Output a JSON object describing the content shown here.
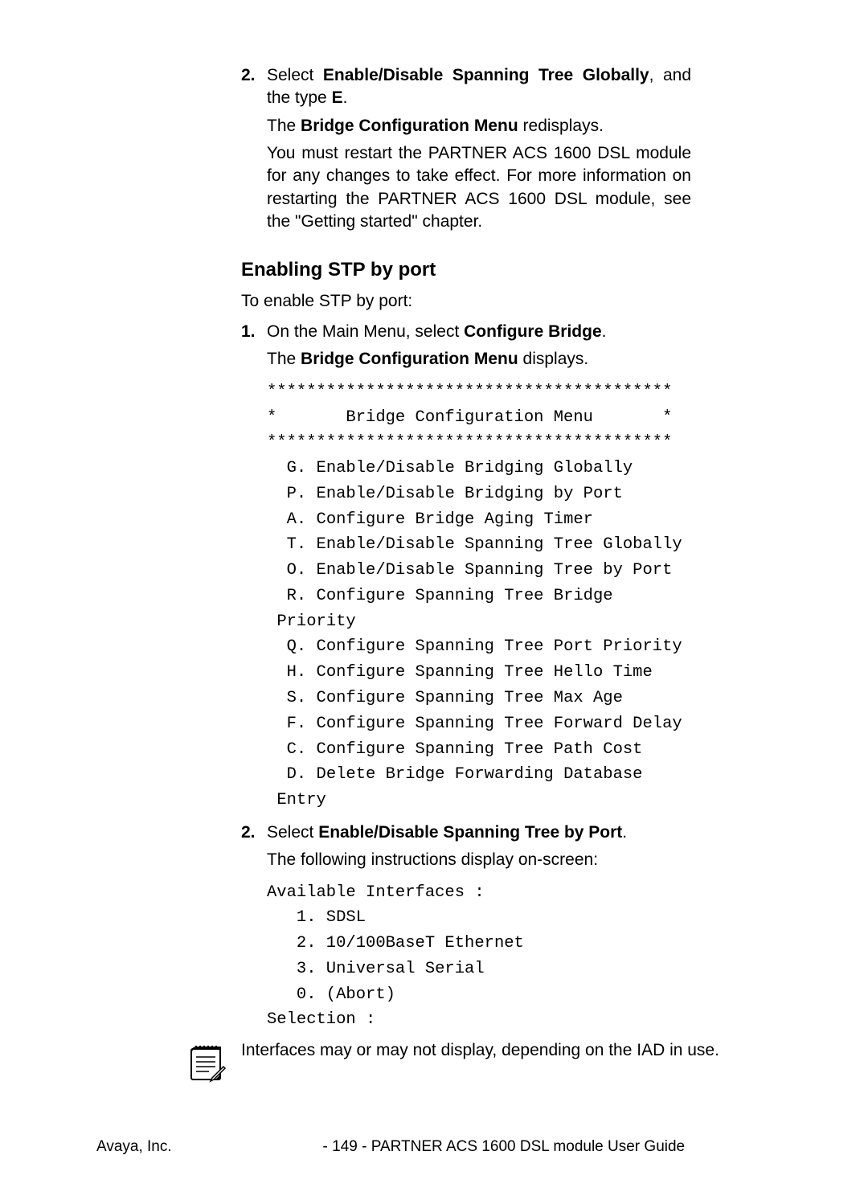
{
  "step2a": {
    "num": "2.",
    "prefix": "Select ",
    "bold1": "Enable/Disable Spanning Tree Globally",
    "mid": ", and the type ",
    "bold2": "E",
    "suffix": "."
  },
  "step2a_p1": {
    "pre": "The ",
    "bold": "Bridge Configuration Menu",
    "post": " redisplays."
  },
  "step2a_p2": "You must restart the PARTNER ACS 1600 DSL module for any changes to take effect.  For more information on restarting the PARTNER ACS 1600 DSL module, see the \"Getting started\" chapter.",
  "heading": "Enabling STP by port",
  "intro": "To enable STP by port:",
  "step1b": {
    "num": "1.",
    "prefix": "On the Main Menu, select ",
    "bold": "Configure Bridge",
    "suffix": "."
  },
  "step1b_p1": {
    "pre": "The ",
    "bold": "Bridge Configuration Menu",
    "post": " displays."
  },
  "menu": "*****************************************\n*       Bridge Configuration Menu       *\n*****************************************\n  G. Enable/Disable Bridging Globally\n  P. Enable/Disable Bridging by Port\n  A. Configure Bridge Aging Timer\n  T. Enable/Disable Spanning Tree Globally\n  O. Enable/Disable Spanning Tree by Port\n  R. Configure Spanning Tree Bridge\n Priority\n  Q. Configure Spanning Tree Port Priority\n  H. Configure Spanning Tree Hello Time\n  S. Configure Spanning Tree Max Age\n  F. Configure Spanning Tree Forward Delay\n  C. Configure Spanning Tree Path Cost\n  D. Delete Bridge Forwarding Database\n Entry",
  "step2b": {
    "num": "2.",
    "prefix": "Select ",
    "bold": "Enable/Disable Spanning Tree by Port",
    "suffix": "."
  },
  "step2b_p1": "The following instructions display on-screen:",
  "interfaces": "Available Interfaces :\n   1. SDSL\n   2. 10/100BaseT Ethernet\n   3. Universal Serial\n   0. (Abort)\nSelection :",
  "note": "Interfaces may or may not display, depending on the IAD in use.",
  "footer": {
    "left": "Avaya, Inc.",
    "center": "- 149 -",
    "right": "PARTNER ACS 1600 DSL module User Guide"
  }
}
